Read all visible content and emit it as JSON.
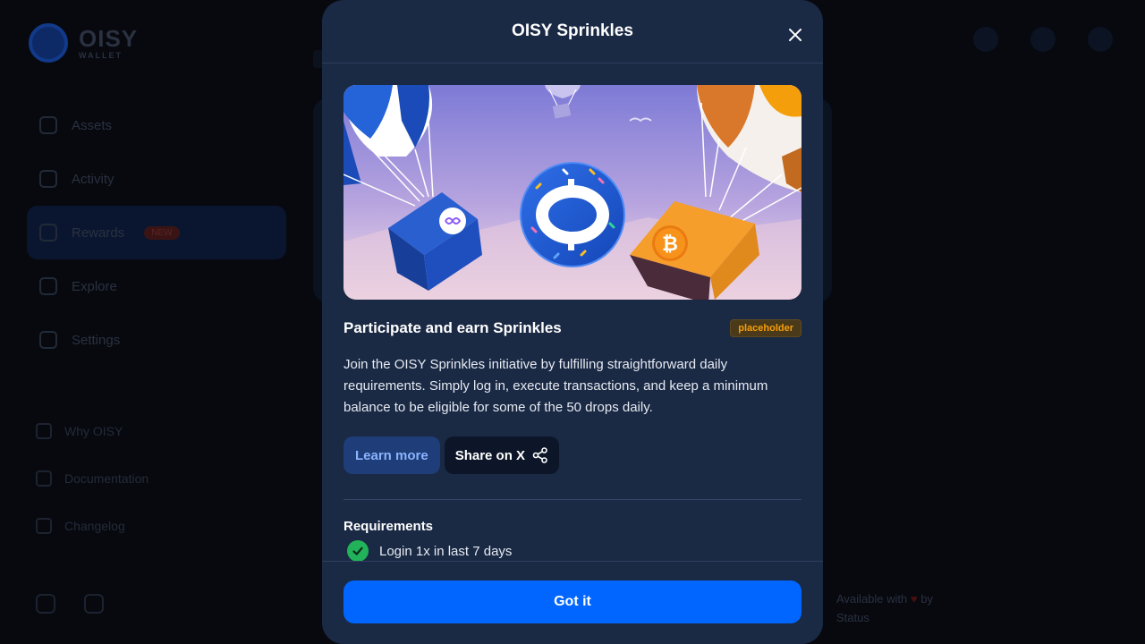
{
  "background_app": {
    "logo_text": "OISY",
    "logo_subtext": "WALLET",
    "nav_items": [
      {
        "label": "Assets"
      },
      {
        "label": "Activity"
      },
      {
        "label": "Rewards",
        "badge": "NEW"
      },
      {
        "label": "Explore"
      },
      {
        "label": "Settings"
      }
    ],
    "links": [
      {
        "label": "Why OISY"
      },
      {
        "label": "Documentation"
      },
      {
        "label": "Changelog"
      }
    ],
    "footer_text_1": "Available with",
    "footer_text_2": "by",
    "footer_text_3": "Status"
  },
  "modal": {
    "title": "OISY Sprinkles",
    "close_icon": "close-icon",
    "section_title": "Participate and earn Sprinkles",
    "badge": "placeholder",
    "description": "Join the OISY Sprinkles initiative by fulfilling straightforward daily requirements. Simply log in, execute transactions, and keep a minimum balance to be eligible for some of the 50 drops daily.",
    "learn_more_label": "Learn more",
    "share_label": "Share on X",
    "share_icon": "share-icon",
    "requirements_title": "Requirements",
    "requirements": [
      {
        "label": "Login 1x in last 7 days",
        "done": true
      }
    ],
    "confirm_label": "Got it"
  },
  "colors": {
    "modal_bg": "#1a2944",
    "primary": "#0066ff",
    "success": "#22b35a",
    "badge_text": "#f59e0b"
  }
}
